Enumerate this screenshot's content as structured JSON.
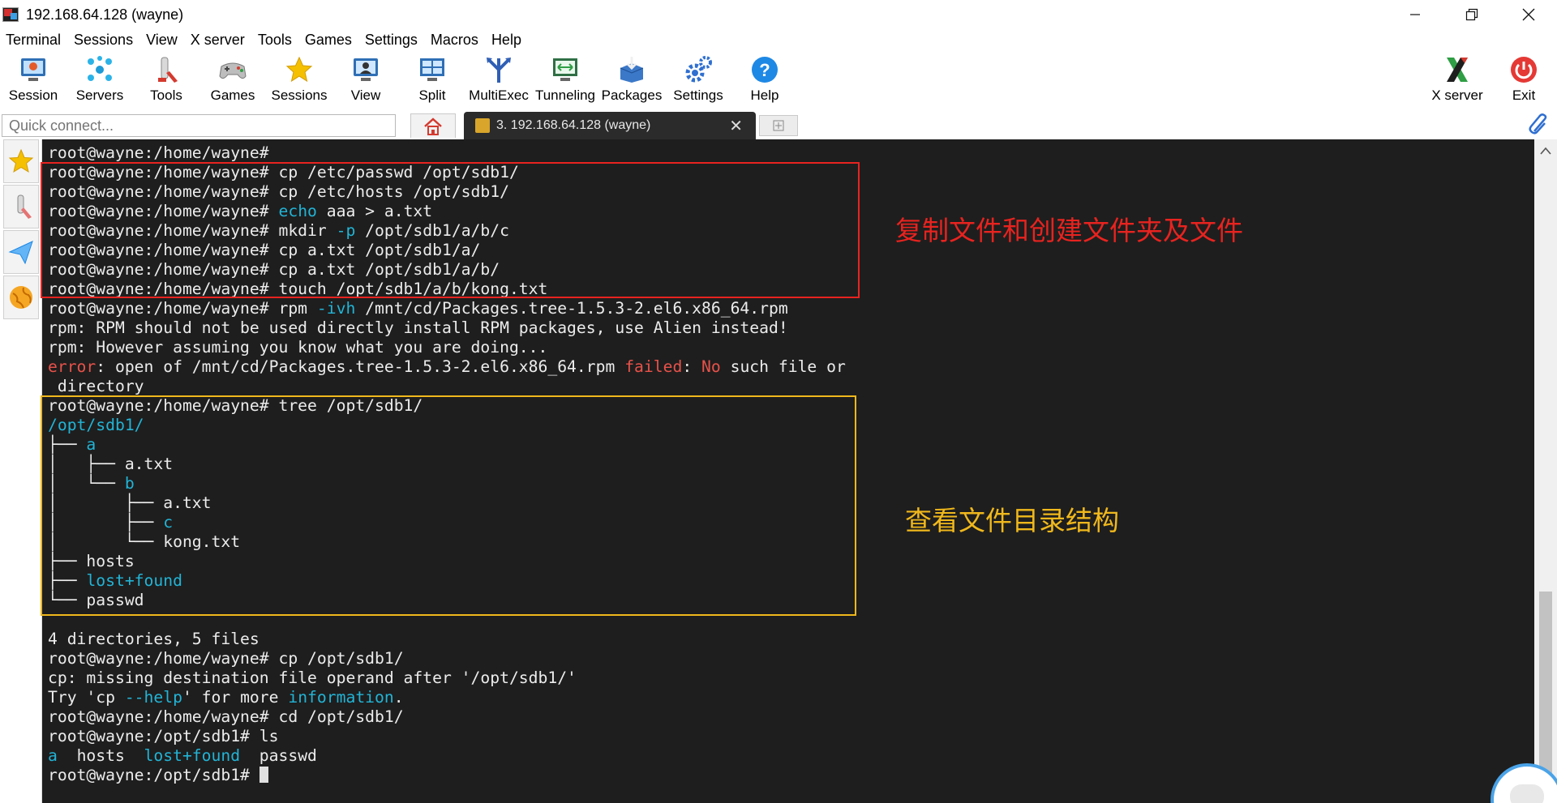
{
  "window": {
    "title": "192.168.64.128 (wayne)",
    "controls": [
      "minimize",
      "restore",
      "close"
    ]
  },
  "menu": [
    "Terminal",
    "Sessions",
    "View",
    "X server",
    "Tools",
    "Games",
    "Settings",
    "Macros",
    "Help"
  ],
  "toolbar": {
    "left": [
      {
        "label": "Session",
        "icon": "session-icon"
      },
      {
        "label": "Servers",
        "icon": "servers-icon"
      },
      {
        "label": "Tools",
        "icon": "tools-icon"
      },
      {
        "label": "Games",
        "icon": "games-icon"
      },
      {
        "label": "Sessions",
        "icon": "star-icon"
      },
      {
        "label": "View",
        "icon": "view-icon"
      },
      {
        "label": "Split",
        "icon": "split-icon"
      },
      {
        "label": "MultiExec",
        "icon": "multiexec-icon"
      },
      {
        "label": "Tunneling",
        "icon": "tunneling-icon"
      },
      {
        "label": "Packages",
        "icon": "packages-icon"
      },
      {
        "label": "Settings",
        "icon": "gear-icon"
      },
      {
        "label": "Help",
        "icon": "help-icon"
      }
    ],
    "right": [
      {
        "label": "X server",
        "icon": "x-server-icon"
      },
      {
        "label": "Exit",
        "icon": "power-icon"
      }
    ]
  },
  "quick_connect": {
    "placeholder": "Quick connect..."
  },
  "tabs": {
    "home_icon": "home-icon",
    "active": {
      "label": "3. 192.168.64.128 (wayne)",
      "close": "✕"
    },
    "new_tab_icon": "plus-icon"
  },
  "sidebar": [
    "star-icon",
    "tools-icon",
    "send-icon",
    "globe-icon"
  ],
  "terminal": {
    "lines": [
      [
        {
          "t": "root@wayne:/home/wayne#"
        }
      ],
      [
        {
          "t": "root@wayne:/home/wayne# cp /etc/passwd /opt/sdb1/"
        }
      ],
      [
        {
          "t": "root@wayne:/home/wayne# cp /etc/hosts /opt/sdb1/"
        }
      ],
      [
        {
          "t": "root@wayne:/home/wayne# "
        },
        {
          "t": "echo",
          "c": "blue"
        },
        {
          "t": " aaa > a.txt"
        }
      ],
      [
        {
          "t": "root@wayne:/home/wayne# mkdir "
        },
        {
          "t": "-p",
          "c": "blue"
        },
        {
          "t": " /opt/sdb1/a/b/c"
        }
      ],
      [
        {
          "t": "root@wayne:/home/wayne# cp a.txt /opt/sdb1/a/"
        }
      ],
      [
        {
          "t": "root@wayne:/home/wayne# cp a.txt /opt/sdb1/a/b/"
        }
      ],
      [
        {
          "t": "root@wayne:/home/wayne# touch /opt/sdb1/a/b/kong.txt"
        }
      ],
      [
        {
          "t": "root@wayne:/home/wayne# rpm "
        },
        {
          "t": "-ivh",
          "c": "blue"
        },
        {
          "t": " /mnt/cd/Packages.tree-1.5.3-2.el6.x86_64.rpm"
        }
      ],
      [
        {
          "t": "rpm: RPM should not be used directly install RPM packages, use Alien instead!"
        }
      ],
      [
        {
          "t": "rpm: However assuming you know what you are doing..."
        }
      ],
      [
        {
          "t": "error",
          "c": "red"
        },
        {
          "t": ": open of /mnt/cd/Packages.tree-1.5.3-2.el6.x86_64.rpm "
        },
        {
          "t": "failed",
          "c": "red"
        },
        {
          "t": ": "
        },
        {
          "t": "No",
          "c": "red"
        },
        {
          "t": " such file or"
        }
      ],
      [
        {
          "t": " directory"
        }
      ],
      [
        {
          "t": "root@wayne:/home/wayne# tree /opt/sdb1/"
        }
      ],
      [
        {
          "t": "/opt/sdb1/",
          "c": "blue"
        }
      ],
      [
        {
          "t": "├── "
        },
        {
          "t": "a",
          "c": "blue"
        }
      ],
      [
        {
          "t": "│   ├── a.txt"
        }
      ],
      [
        {
          "t": "│   └── "
        },
        {
          "t": "b",
          "c": "blue"
        }
      ],
      [
        {
          "t": "│       ├── a.txt"
        }
      ],
      [
        {
          "t": "│       ├── "
        },
        {
          "t": "c",
          "c": "blue"
        }
      ],
      [
        {
          "t": "│       └── kong.txt"
        }
      ],
      [
        {
          "t": "├── hosts"
        }
      ],
      [
        {
          "t": "├── "
        },
        {
          "t": "lost+found",
          "c": "blue"
        }
      ],
      [
        {
          "t": "└── passwd"
        }
      ],
      [
        {
          "t": ""
        }
      ],
      [
        {
          "t": "4 directories, 5 files"
        }
      ],
      [
        {
          "t": "root@wayne:/home/wayne# cp /opt/sdb1/"
        }
      ],
      [
        {
          "t": "cp: missing destination file operand after '/opt/sdb1/'"
        }
      ],
      [
        {
          "t": "Try 'cp "
        },
        {
          "t": "--help",
          "c": "blue"
        },
        {
          "t": "' for more "
        },
        {
          "t": "information",
          "c": "blue"
        },
        {
          "t": "."
        }
      ],
      [
        {
          "t": "root@wayne:/home/wayne# cd /opt/sdb1/"
        }
      ],
      [
        {
          "t": "root@wayne:/opt/sdb1# ls"
        }
      ],
      [
        {
          "t": "a",
          "c": "blue"
        },
        {
          "t": "  hosts  "
        },
        {
          "t": "lost+found",
          "c": "blue"
        },
        {
          "t": "  passwd"
        }
      ],
      [
        {
          "t": "root@wayne:/opt/sdb1# "
        },
        {
          "t": "",
          "cursor": true
        }
      ]
    ],
    "annotations": {
      "copy_note": "复制文件和创建文件夹及文件",
      "tree_note": "查看文件目录结构"
    }
  },
  "colors": {
    "terminal_bg": "#1e1e1e",
    "terminal_fg": "#ececec",
    "highlight_blue": "#22b4d6",
    "error_red": "#e8524a",
    "box_red": "#e8231f",
    "box_yellow": "#f0b81c"
  }
}
